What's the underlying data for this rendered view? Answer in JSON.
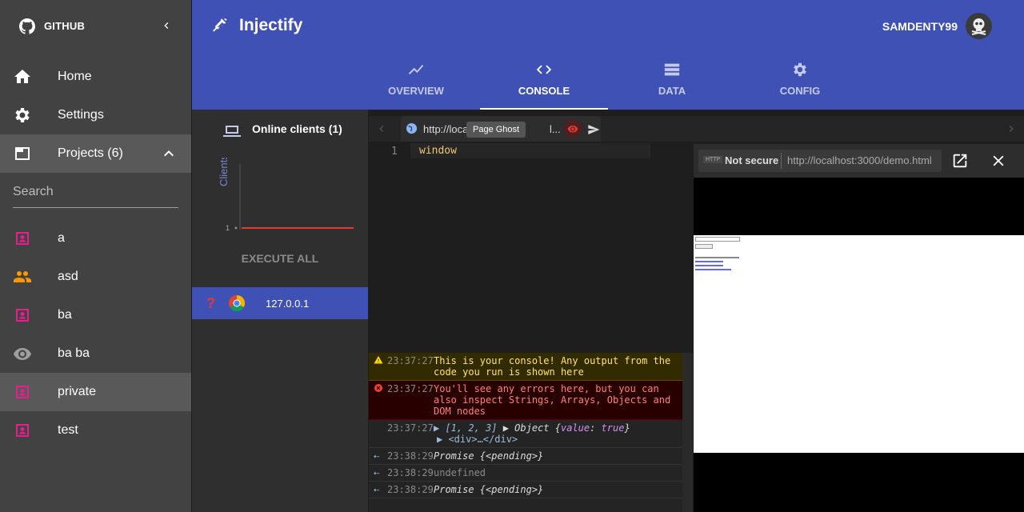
{
  "sidebar": {
    "brand": "GITHUB",
    "items": [
      {
        "label": "Home",
        "icon": "home-icon"
      },
      {
        "label": "Settings",
        "icon": "gear-icon"
      },
      {
        "label": "Projects (6)",
        "icon": "window-icon"
      }
    ],
    "search_placeholder": "Search",
    "projects": [
      {
        "label": "a",
        "icon": "person-icon"
      },
      {
        "label": "asd",
        "icon": "group-icon"
      },
      {
        "label": "ba",
        "icon": "person-icon"
      },
      {
        "label": "ba ba",
        "icon": "eye-icon"
      },
      {
        "label": "private",
        "icon": "person-icon"
      },
      {
        "label": "test",
        "icon": "person-icon"
      }
    ]
  },
  "header": {
    "title": "Injectify",
    "username": "SAMDENTY99"
  },
  "tabs": [
    {
      "label": "OVERVIEW"
    },
    {
      "label": "CONSOLE"
    },
    {
      "label": "DATA"
    },
    {
      "label": "CONFIG"
    }
  ],
  "clients": {
    "title": "Online clients (1)",
    "chart_ylabel": "Clients",
    "chart_tick": "1",
    "execute_label": "EXECUTE ALL",
    "client_ip": "127.0.0.1"
  },
  "editor": {
    "tab_url": "http://loca",
    "tab_url_suffix": "l...",
    "tooltip": "Page Ghost",
    "line_number": "1",
    "code": "window"
  },
  "console": {
    "lines": [
      {
        "time": "23:37:27",
        "text": "This is your console! Any output from the code you run is shown here"
      },
      {
        "time": "23:37:27",
        "text": "You'll see any errors here, but you can also inspect Strings, Arrays, Objects and DOM nodes"
      },
      {
        "time": "23:37:27",
        "text": "[1, 2, 3]"
      },
      {
        "time": "23:38:29",
        "text": "Promise {<pending>}"
      },
      {
        "time": "23:38:29",
        "text": "undefined"
      },
      {
        "time": "23:38:29",
        "text": "Promise {<pending>}"
      }
    ]
  },
  "preview": {
    "badge": "HTTP",
    "security": "Not secure",
    "url": "http://localhost:3000/demo.html"
  },
  "colors": {
    "primary": "#3f51b5",
    "sidebar": "#424242",
    "accent_pink": "#e91e8c",
    "accent_orange": "#ff9800"
  }
}
